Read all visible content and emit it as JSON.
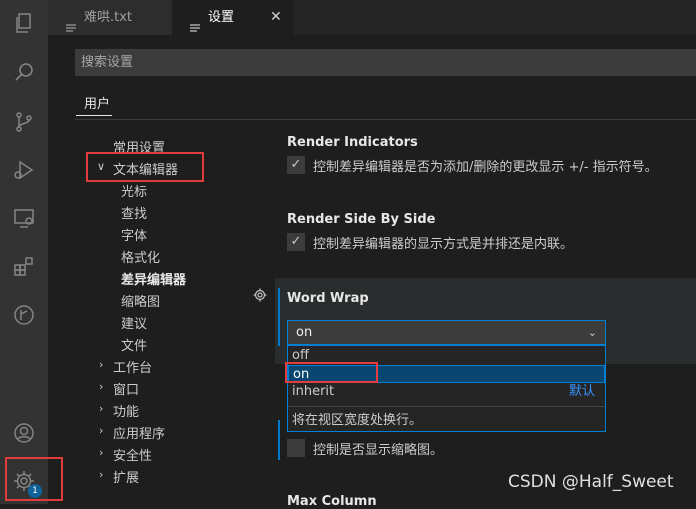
{
  "tabs": [
    {
      "label": "难哄.txt",
      "icon": "file-lines-icon",
      "active": false
    },
    {
      "label": "设置",
      "icon": "settings-file-icon",
      "active": true,
      "close": "✕"
    }
  ],
  "search": {
    "placeholder": "搜索设置"
  },
  "scope_tab": "用户",
  "toc": {
    "common": "常用设置",
    "text_editor": "文本编辑器",
    "sub": [
      "光标",
      "查找",
      "字体",
      "格式化",
      "差异编辑器",
      "缩略图",
      "建议",
      "文件"
    ],
    "groups": [
      "工作台",
      "窗口",
      "功能",
      "应用程序",
      "安全性",
      "扩展"
    ]
  },
  "settings": {
    "render_indicators": {
      "title": "Render Indicators",
      "desc": "控制差异编辑器是否为添加/删除的更改显示 +/- 指示符号。",
      "check": "✓"
    },
    "render_side_by_side": {
      "title": "Render Side By Side",
      "desc": "控制差异编辑器的显示方式是并排还是内联。",
      "check": "✓"
    },
    "word_wrap": {
      "title": "Word Wrap",
      "value": "on",
      "caret": "⌄",
      "options": [
        "off",
        "on",
        "inherit"
      ],
      "default_label": "默认",
      "option_desc": "将在视区宽度处换行。"
    },
    "minimap": {
      "desc": "控制是否显示缩略图。"
    },
    "max_column": {
      "title": "Max Column"
    }
  },
  "activity": {
    "badge": "1"
  },
  "watermark": "CSDN @Half_Sweet"
}
